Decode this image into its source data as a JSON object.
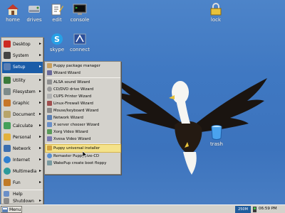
{
  "desktop_icons": [
    {
      "label": "home",
      "icon": "house-icon"
    },
    {
      "label": "drives",
      "icon": "drives-icon"
    },
    {
      "label": "edit",
      "icon": "edit-icon"
    },
    {
      "label": "console",
      "icon": "console-icon"
    },
    {
      "label": "lock",
      "icon": "lock-icon"
    },
    {
      "label": "skype",
      "icon": "skype-icon"
    },
    {
      "label": "connect",
      "icon": "connect-icon"
    },
    {
      "label": "trash",
      "icon": "trash-icon"
    }
  ],
  "main_menu": {
    "items": [
      {
        "label": "Desktop",
        "submenu": true,
        "icon_color": "#cc2a22"
      },
      {
        "label": "System",
        "submenu": true,
        "icon_color": "#444444"
      },
      {
        "label": "Setup",
        "submenu": true,
        "icon_color": "#5a7fb4",
        "active": true
      },
      {
        "label": "Utility",
        "submenu": true,
        "icon_color": "#3a7a3a"
      },
      {
        "label": "Filesystem",
        "submenu": true,
        "icon_color": "#7d8b8a"
      },
      {
        "label": "Graphic",
        "submenu": true,
        "icon_color": "#c6762a"
      },
      {
        "label": "Document",
        "submenu": true,
        "icon_color": "#b7a46a"
      },
      {
        "label": "Calculate",
        "submenu": true,
        "icon_color": "#44a05a"
      },
      {
        "label": "Personal",
        "submenu": true,
        "icon_color": "#e2b13c"
      },
      {
        "label": "Network",
        "submenu": true,
        "icon_color": "#3c6fb0"
      },
      {
        "label": "Internet",
        "submenu": true,
        "icon_color": "#2e7fd0"
      },
      {
        "label": "Multimedia",
        "submenu": true,
        "icon_color": "#2c9a9a"
      },
      {
        "label": "Fun",
        "submenu": true,
        "icon_color": "#c07b28"
      },
      {
        "label": "Help",
        "submenu": false,
        "icon_color": "#6a8fc8"
      },
      {
        "label": "Shutdown",
        "submenu": true,
        "icon_color": "#8a8a8a"
      }
    ]
  },
  "setup_menu": {
    "items": [
      {
        "label": "Puppy package manager",
        "icon_color": "#c8a060"
      },
      {
        "label": "Wizard Wizard",
        "icon_color": "#6a6a9a"
      },
      {
        "label": "ALSA sound Wizard",
        "icon_color": "#909090"
      },
      {
        "label": "CD/DVD drive Wizard",
        "icon_color": "#9a9a9a"
      },
      {
        "label": "CUPS Printer Wizard",
        "icon_color": "#b0b0b0"
      },
      {
        "label": "Linux-Firewall Wizard",
        "icon_color": "#a05050"
      },
      {
        "label": "Mouse/keyboard Wizard",
        "icon_color": "#8a8a8a"
      },
      {
        "label": "Network Wizard",
        "icon_color": "#5a7fb4"
      },
      {
        "label": "X server chooser Wizard",
        "icon_color": "#6a8fc8"
      },
      {
        "label": "Xorg Video Wizard",
        "icon_color": "#5a9a5a"
      },
      {
        "label": "Xvesa Video Wizard",
        "icon_color": "#7a7ab0"
      },
      {
        "label": "Puppy universal installer",
        "icon_color": "#d0a040",
        "active": true
      },
      {
        "label": "Remaster Puppy live-CD",
        "icon_color": "#5a8fd0"
      },
      {
        "label": "WakePup create boot floppy",
        "icon_color": "#7a9aa0"
      }
    ]
  },
  "taskbar": {
    "menu_label": "Menu",
    "memory": "250M",
    "clock": "06:59 PM"
  }
}
